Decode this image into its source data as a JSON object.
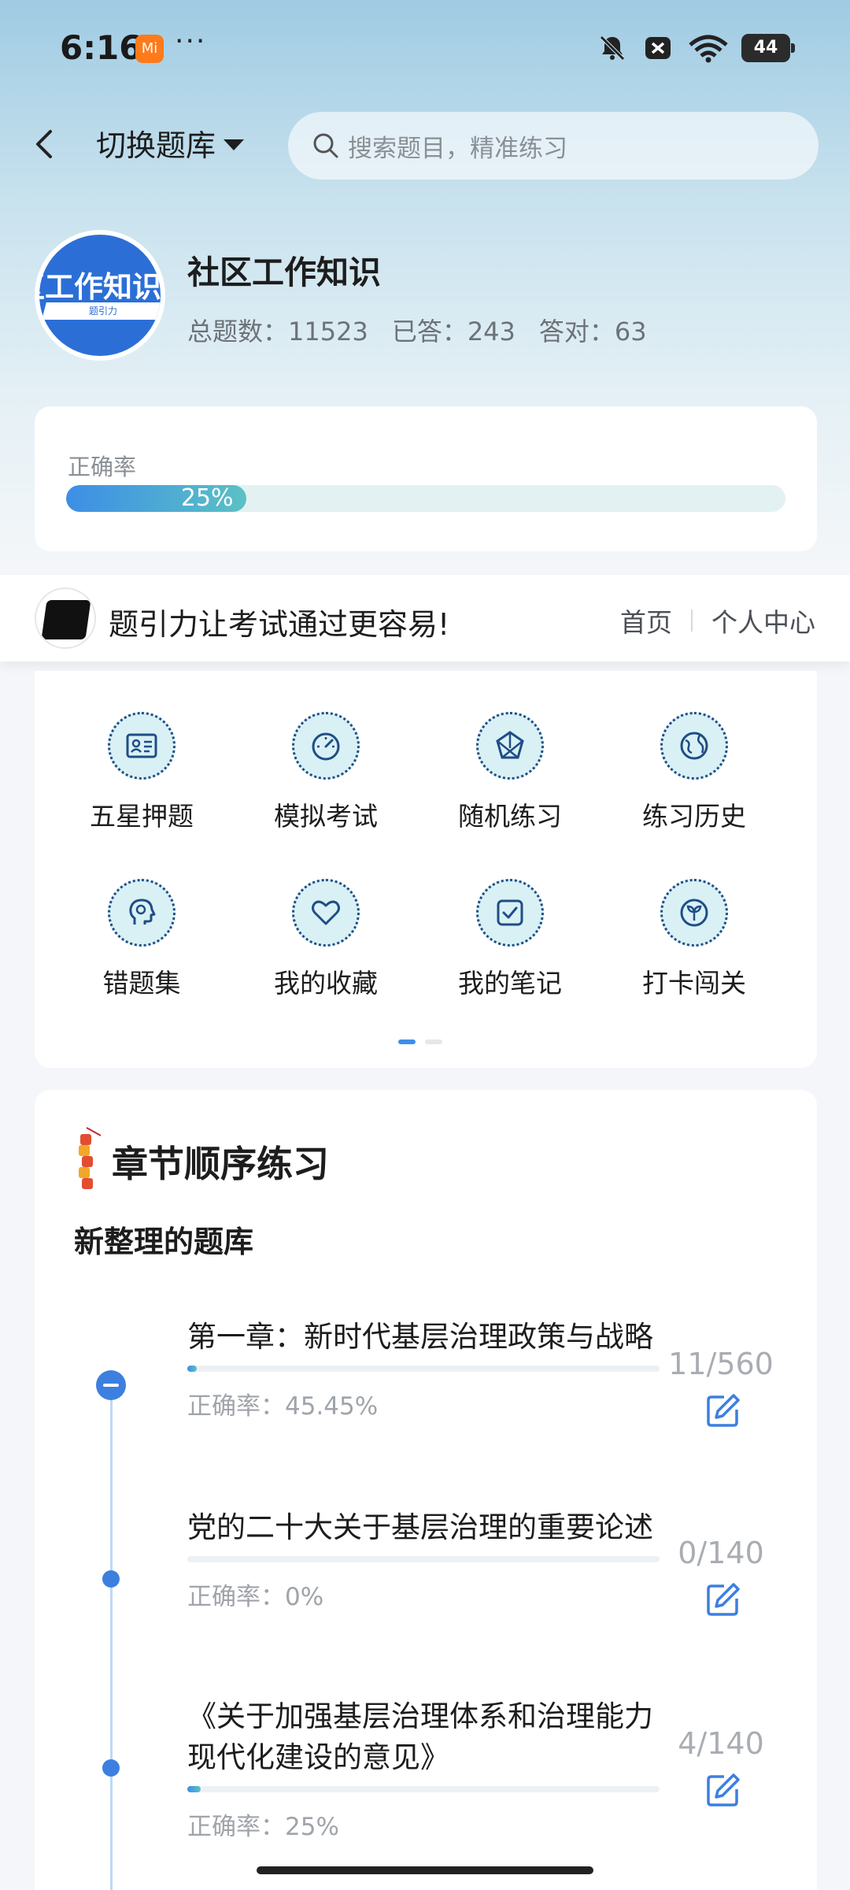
{
  "status": {
    "time": "6:16",
    "app_badge": "Mi",
    "more": "···",
    "battery": "44"
  },
  "nav": {
    "switch_label": "切换题库",
    "search_placeholder": "搜索题目，精准练习"
  },
  "bank": {
    "avatar_text": "区工作知识",
    "avatar_sub": "题引力",
    "title": "社区工作知识",
    "total": "总题数：11523",
    "answered": "已答：243",
    "correct": "答对：63"
  },
  "accuracy": {
    "label": "正确率",
    "value_text": "25%",
    "fraction": 0.25
  },
  "promo": {
    "text": "题引力让考试通过更容易!",
    "link_home": "首页",
    "link_profile": "个人中心"
  },
  "features": [
    {
      "label": "五星押题",
      "icon": "id-card-icon"
    },
    {
      "label": "模拟考试",
      "icon": "gauge-icon"
    },
    {
      "label": "随机练习",
      "icon": "random-icon"
    },
    {
      "label": "练习历史",
      "icon": "globe-icon"
    },
    {
      "label": "错题集",
      "icon": "head-icon"
    },
    {
      "label": "我的收藏",
      "icon": "heart-icon"
    },
    {
      "label": "我的笔记",
      "icon": "note-icon"
    },
    {
      "label": "打卡闯关",
      "icon": "badge-icon"
    }
  ],
  "chapters_section": {
    "title": "章节顺序练习",
    "subtitle": "新整理的题库",
    "items": [
      {
        "title": "第一章：新时代基层治理政策与战略",
        "accuracy": "正确率：45.45%",
        "count": "11/560",
        "progress": 0.0196
      },
      {
        "title": "党的二十大关于基层治理的重要论述",
        "accuracy": "正确率：0%",
        "count": "0/140",
        "progress": 0
      },
      {
        "title": "《关于加强基层治理体系和治理能力现代化建设的意见》",
        "accuracy": "正确率：25%",
        "count": "4/140",
        "progress": 0.0286
      }
    ]
  }
}
